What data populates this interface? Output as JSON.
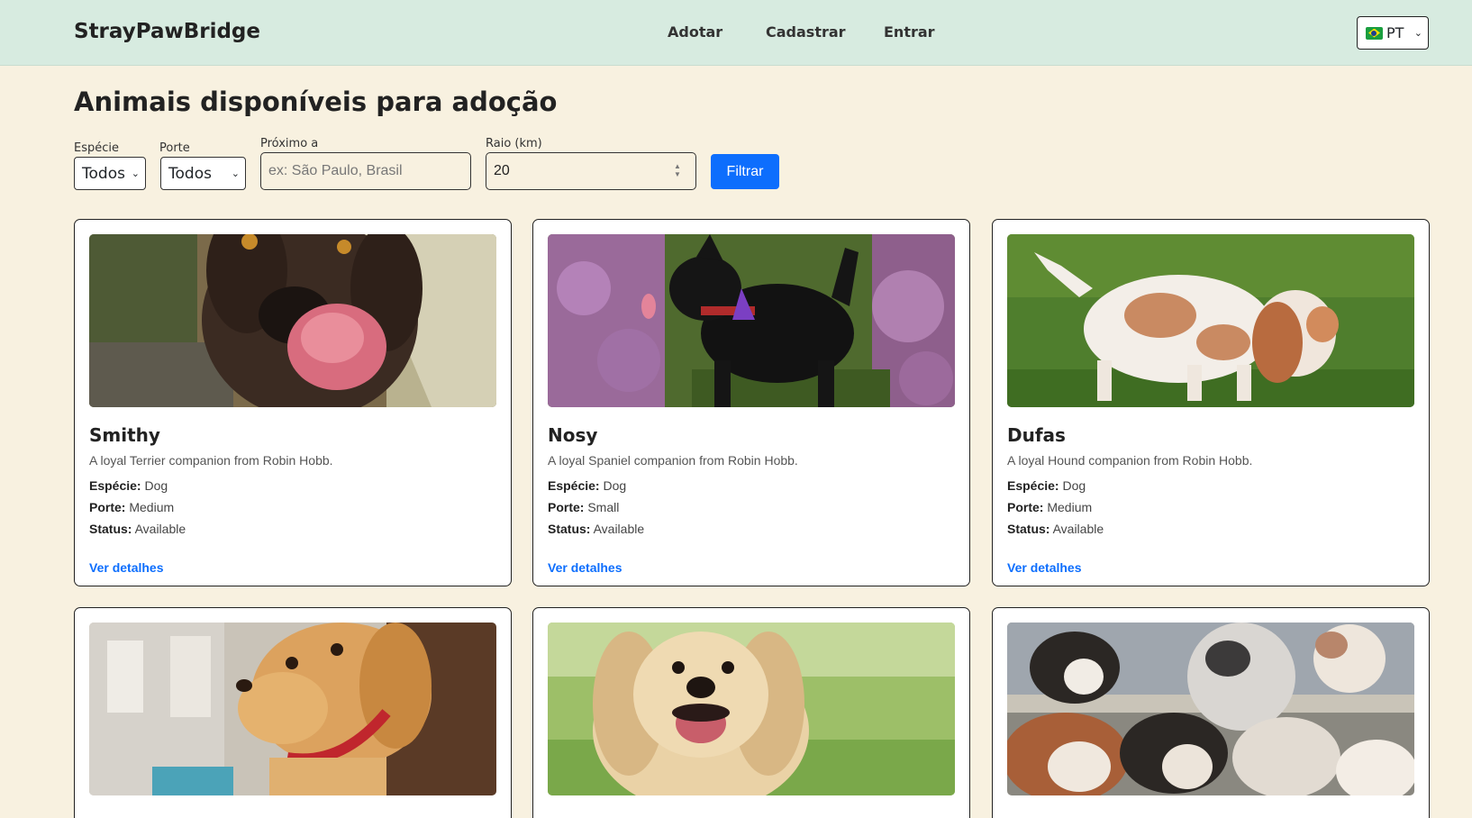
{
  "header": {
    "brand": "StrayPawBridge",
    "nav": [
      "Adotar",
      "Cadastrar",
      "Entrar"
    ],
    "language": "PT"
  },
  "page_title": "Animais disponíveis para adoção",
  "filters": {
    "species_label": "Espécie",
    "species_value": "Todos",
    "size_label": "Porte",
    "size_value": "Todos",
    "near_label": "Próximo a",
    "near_placeholder": "ex: São Paulo, Brasil",
    "radius_label": "Raio (km)",
    "radius_value": "20",
    "filter_button": "Filtrar"
  },
  "labels": {
    "species": "Espécie:",
    "size": "Porte:",
    "status": "Status:",
    "details": "Ver detalhes"
  },
  "animals": [
    {
      "name": "Smithy",
      "description": "A loyal Terrier companion from Robin Hobb.",
      "species": "Dog",
      "size": "Medium",
      "status": "Available"
    },
    {
      "name": "Nosy",
      "description": "A loyal Spaniel companion from Robin Hobb.",
      "species": "Dog",
      "size": "Small",
      "status": "Available"
    },
    {
      "name": "Dufas",
      "description": "A loyal Hound companion from Robin Hobb.",
      "species": "Dog",
      "size": "Medium",
      "status": "Available"
    }
  ]
}
